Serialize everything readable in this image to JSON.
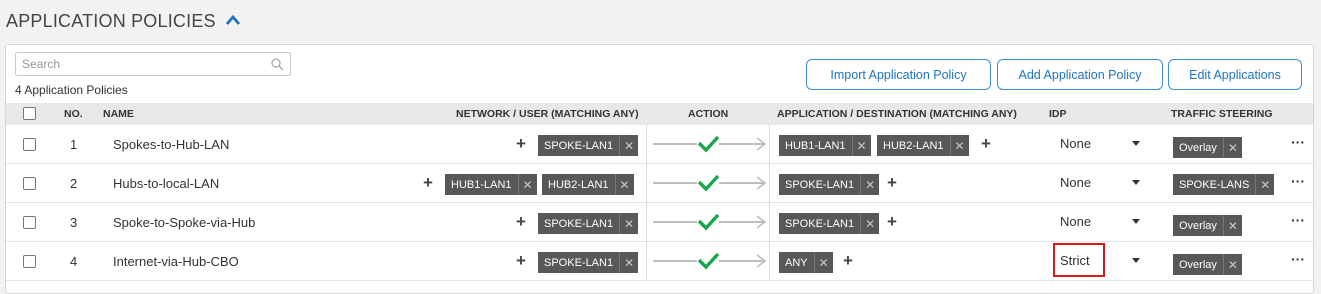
{
  "section": {
    "title": "APPLICATION POLICIES"
  },
  "search": {
    "placeholder": "Search"
  },
  "summary": {
    "count_text": "4 Application Policies"
  },
  "buttons": {
    "import": "Import Application Policy",
    "add": "Add Application Policy",
    "edit": "Edit Applications"
  },
  "columns": {
    "no": "NO.",
    "name": "NAME",
    "network": "NETWORK / USER (MATCHING ANY)",
    "action": "ACTION",
    "application": "APPLICATION / DESTINATION (MATCHING ANY)",
    "idp": "IDP",
    "steering": "TRAFFIC STEERING"
  },
  "rows": [
    {
      "no": "1",
      "name": "Spokes-to-Hub-LAN",
      "network": [
        "SPOKE-LAN1"
      ],
      "apps": [
        "HUB1-LAN1",
        "HUB2-LAN1"
      ],
      "idp": "None",
      "steering": "Overlay"
    },
    {
      "no": "2",
      "name": "Hubs-to-local-LAN",
      "network": [
        "HUB1-LAN1",
        "HUB2-LAN1"
      ],
      "apps": [
        "SPOKE-LAN1"
      ],
      "idp": "None",
      "steering": "SPOKE-LANS"
    },
    {
      "no": "3",
      "name": "Spoke-to-Spoke-via-Hub",
      "network": [
        "SPOKE-LAN1"
      ],
      "apps": [
        "SPOKE-LAN1"
      ],
      "idp": "None",
      "steering": "Overlay"
    },
    {
      "no": "4",
      "name": "Internet-via-Hub-CBO",
      "network": [
        "SPOKE-LAN1"
      ],
      "apps": [
        "ANY"
      ],
      "idp": "Strict",
      "steering": "Overlay"
    }
  ],
  "colors": {
    "accent": "#1e73be",
    "tag_bg": "#585858",
    "check": "#1aa64a",
    "highlight": "#d6181f"
  },
  "icons": {
    "collapse": "chevron-up-icon",
    "search": "search-icon",
    "remove": "close-icon",
    "add": "plus-icon",
    "allow": "check-icon",
    "more": "more-icon"
  }
}
